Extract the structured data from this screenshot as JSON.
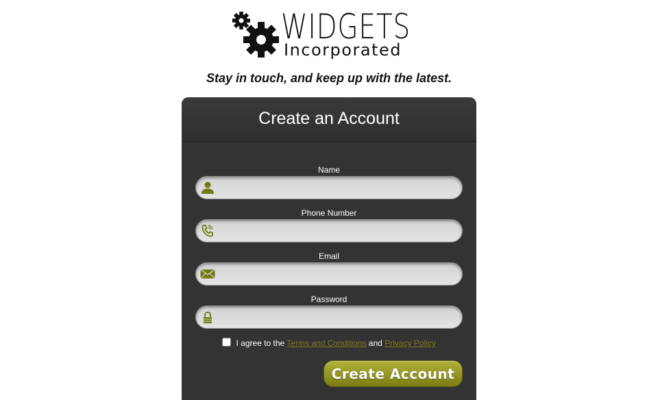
{
  "logo": {
    "title": "WIDGETS",
    "subtitle": "Incorporated",
    "icon": "gears-icon"
  },
  "tagline": "Stay in touch, and keep up with the latest.",
  "form": {
    "title": "Create an Account",
    "fields": [
      {
        "label": "Name",
        "icon": "person-icon",
        "value": "",
        "placeholder": ""
      },
      {
        "label": "Phone Number",
        "icon": "phone-icon",
        "value": "",
        "placeholder": ""
      },
      {
        "label": "Email",
        "icon": "envelope-icon",
        "value": "",
        "placeholder": ""
      },
      {
        "label": "Password",
        "icon": "lock-icon",
        "value": "",
        "placeholder": ""
      }
    ],
    "agree": {
      "prefix": "I agree to the",
      "terms_link": "Terms and Conditions",
      "and": "and",
      "privacy_link": "Privacy Policy",
      "checked": false
    },
    "submit_label": "Create Account"
  },
  "colors": {
    "accent": "#7b7d14",
    "card_bg": "#333333",
    "icon": "#6f7a10"
  }
}
